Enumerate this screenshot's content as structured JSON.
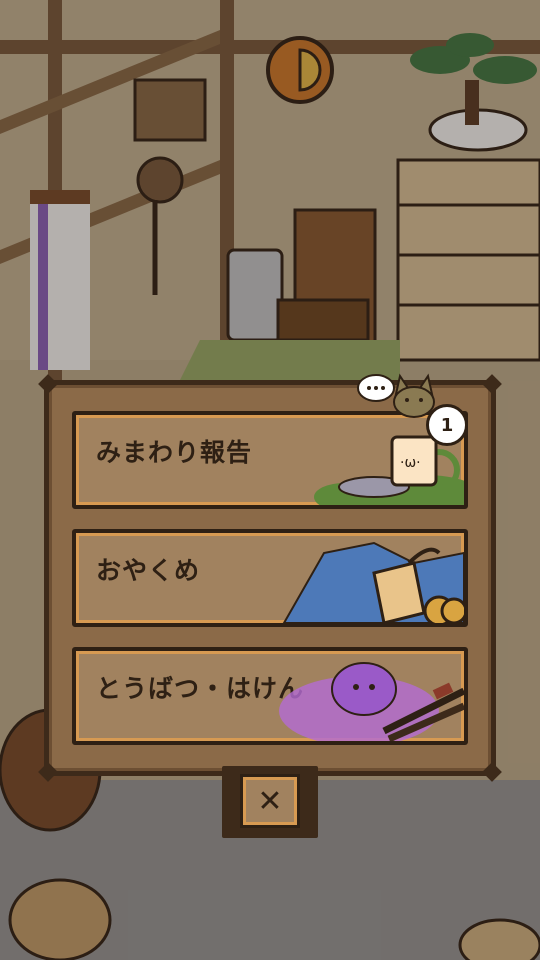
{
  "menu": {
    "items": [
      {
        "label": "みまわり報告"
      },
      {
        "label": "おやくめ"
      },
      {
        "label": "とうばつ・はけん"
      }
    ],
    "notification_count": "1",
    "close_symbol": "✕"
  },
  "icons": {
    "speech": "speech-bubble-icon",
    "cat": "cat-head-icon",
    "close": "close-icon"
  },
  "colors": {
    "panel": "#8b6a48",
    "button_fill": "#a1825f",
    "button_border": "#2e2014",
    "button_glow": "#d79a52",
    "text": "#2e2014"
  }
}
